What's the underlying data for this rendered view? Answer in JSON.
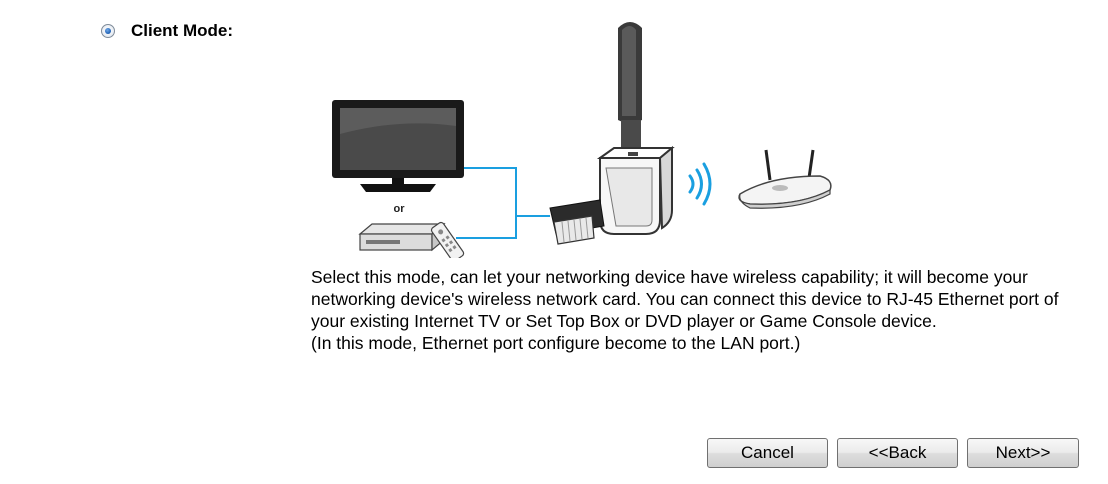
{
  "mode": {
    "label": "Client Mode:",
    "selected": true
  },
  "illustration": {
    "or_label": "or"
  },
  "description": {
    "text": "Select this mode, can let your networking device have wireless capability; it will become your networking device's wireless network card. You can connect this device to RJ-45 Ethernet port of your existing Internet TV or Set Top Box or DVD player or Game Console device.",
    "note": "(In this mode, Ethernet port configure become to the LAN port.)"
  },
  "buttons": {
    "cancel": "Cancel",
    "back": "<<Back",
    "next": "Next>>"
  },
  "colors": {
    "cable": "#1a9fe0",
    "wifi_waves": "#1a9fe0",
    "radio_dot": "#1d5fb3"
  }
}
